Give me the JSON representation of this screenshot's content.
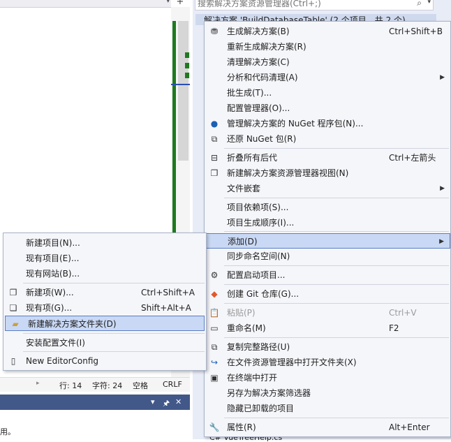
{
  "editor": {
    "status": {
      "line": "行: 14",
      "col": "字符: 24",
      "spaces": "空格",
      "eol": "CRLF"
    },
    "panel_controls": {
      "dropdown": "▾",
      "pin": "🖈",
      "close": "✕"
    },
    "output_text": "用。"
  },
  "solution_explorer": {
    "search_placeholder": "搜索解决方案资源管理器(Ctrl+;)",
    "root_item": "解决方案 'BuildDatabaseTable' (2 个项目，共 2 个)",
    "bottom_item": "C# VueTreeHelp.cs"
  },
  "main_menu": {
    "items": [
      {
        "label": "生成解决方案(B)",
        "shortcut": "Ctrl+Shift+B",
        "icon": "build-solution-icon"
      },
      {
        "label": "重新生成解决方案(R)",
        "shortcut": ""
      },
      {
        "label": "清理解决方案(C)",
        "shortcut": ""
      },
      {
        "label": "分析和代码清理(A)",
        "shortcut": "",
        "submenu": true
      },
      {
        "label": "批生成(T)...",
        "shortcut": ""
      },
      {
        "label": "配置管理器(O)...",
        "shortcut": ""
      },
      {
        "label": "管理解决方案的 NuGet 程序包(N)...",
        "shortcut": "",
        "icon": "nuget-icon"
      },
      {
        "label": "还原 NuGet 包(R)",
        "shortcut": "",
        "icon": "restore-icon"
      },
      {
        "label": "折叠所有后代",
        "shortcut": "Ctrl+左箭头",
        "icon": "collapse-icon"
      },
      {
        "label": "新建解决方案资源管理器视图(N)",
        "shortcut": "",
        "icon": "new-view-icon"
      },
      {
        "label": "文件嵌套",
        "shortcut": "",
        "submenu": true
      },
      {
        "label": "项目依赖项(S)...",
        "shortcut": ""
      },
      {
        "label": "项目生成顺序(I)...",
        "shortcut": ""
      },
      {
        "label": "添加(D)",
        "shortcut": "",
        "submenu": true,
        "highlighted": true
      },
      {
        "label": "同步命名空间(N)",
        "shortcut": ""
      },
      {
        "label": "配置启动项目...",
        "shortcut": "",
        "icon": "gear-icon"
      },
      {
        "label": "创建 Git 仓库(G)...",
        "shortcut": "",
        "icon": "git-icon"
      },
      {
        "label": "粘贴(P)",
        "shortcut": "Ctrl+V",
        "disabled": true,
        "icon": "paste-icon"
      },
      {
        "label": "重命名(M)",
        "shortcut": "F2",
        "icon": "rename-icon"
      },
      {
        "label": "复制完整路径(U)",
        "shortcut": "",
        "icon": "copy-path-icon"
      },
      {
        "label": "在文件资源管理器中打开文件夹(X)",
        "shortcut": "",
        "icon": "open-folder-icon"
      },
      {
        "label": "在终端中打开",
        "shortcut": "",
        "icon": "terminal-icon"
      },
      {
        "label": "另存为解决方案筛选器",
        "shortcut": ""
      },
      {
        "label": "隐藏已卸载的项目",
        "shortcut": ""
      },
      {
        "label": "属性(R)",
        "shortcut": "Alt+Enter",
        "icon": "wrench-icon"
      }
    ]
  },
  "sub_menu": {
    "items": [
      {
        "label": "新建项目(N)...",
        "shortcut": ""
      },
      {
        "label": "现有项目(E)...",
        "shortcut": ""
      },
      {
        "label": "现有网站(B)...",
        "shortcut": ""
      },
      {
        "label": "新建项(W)...",
        "shortcut": "Ctrl+Shift+A",
        "icon": "new-item-icon"
      },
      {
        "label": "现有项(G)...",
        "shortcut": "Shift+Alt+A",
        "icon": "existing-item-icon"
      },
      {
        "label": "新建解决方案文件夹(D)",
        "shortcut": "",
        "icon": "folder-icon",
        "highlighted": true
      },
      {
        "label": "安装配置文件(I)",
        "shortcut": ""
      },
      {
        "label": "New EditorConfig",
        "shortcut": "",
        "icon": "file-icon"
      }
    ]
  }
}
